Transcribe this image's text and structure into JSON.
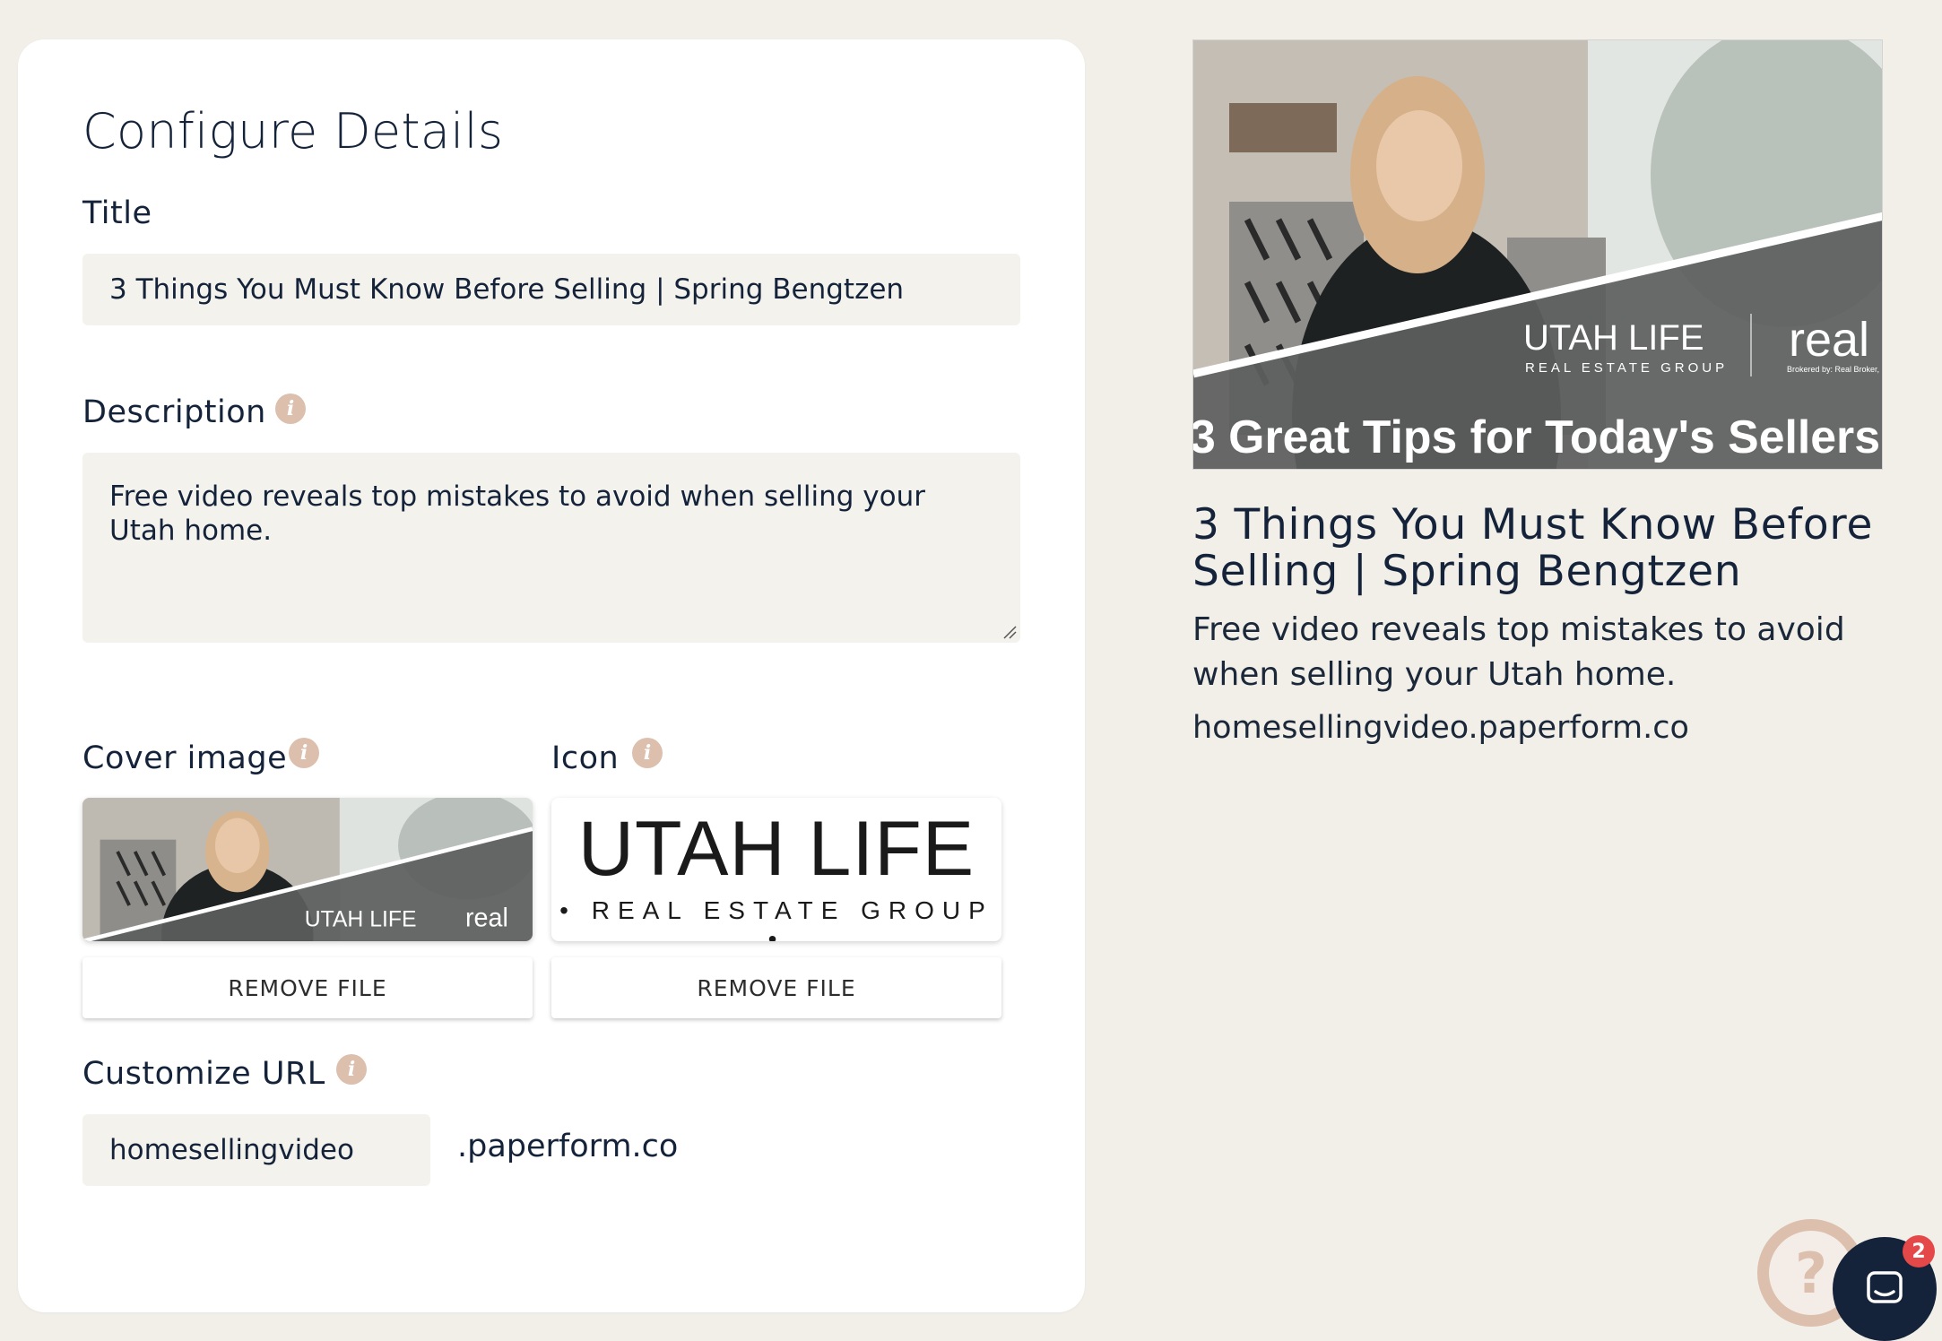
{
  "form": {
    "heading": "Configure Details",
    "title_label": "Title",
    "title_value": "3 Things You Must Know Before Selling | Spring Bengtzen",
    "description_label": "Description",
    "description_value": "Free video reveals top mistakes to avoid when selling your Utah home.",
    "cover_label": "Cover image",
    "icon_label": "Icon",
    "remove_file_label": "REMOVE FILE",
    "url_label": "Customize URL",
    "url_value": "homesellingvideo",
    "url_suffix": ".paperform.co",
    "info_glyph": "i"
  },
  "images": {
    "brand_name": "UTAH LIFE",
    "brand_sub": "REAL ESTATE GROUP",
    "brand_sub_dotted": "• REAL ESTATE GROUP •",
    "real_logo": "real",
    "real_brokered": "Brokered by: Real Broker, LLC",
    "cover_caption": "3 Great Tips for Today's Sellers"
  },
  "preview": {
    "title": "3 Things You Must Know Before Selling | Spring Bengtzen",
    "description": "Free video reveals top mistakes to avoid when selling your Utah home.",
    "url": "homesellingvideo.paperform.co"
  },
  "widgets": {
    "help_glyph": "?",
    "chat_badge_count": "2"
  },
  "colors": {
    "page_bg": "#f2efe9",
    "text_primary": "#14233a",
    "accent_tan": "#dcbfad",
    "badge_red": "#e54848"
  }
}
